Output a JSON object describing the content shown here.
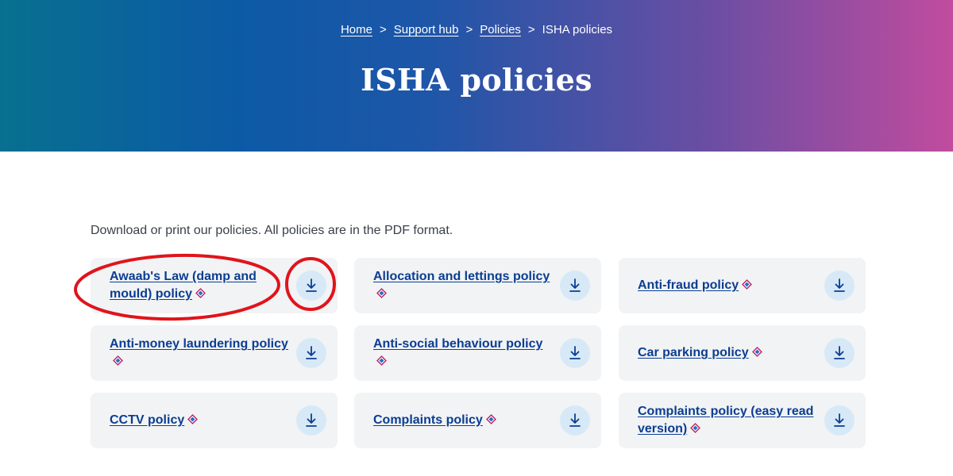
{
  "breadcrumb": {
    "home": "Home",
    "support_hub": "Support hub",
    "policies": "Policies",
    "current": "ISHA policies",
    "separator": ">"
  },
  "page": {
    "title": "ISHA policies",
    "intro": "Download or print our policies. All policies are in the PDF format."
  },
  "colors": {
    "link": "#0b3d91",
    "card_bg": "#f1f3f5",
    "download_circle": "#d7e9f7",
    "annotation_red": "#e0141b"
  },
  "policies": [
    {
      "label": "Awaab's Law (damp and mould) policy",
      "icon": "pdf-icon",
      "action_icon": "download-icon"
    },
    {
      "label": "Allocation and lettings policy",
      "icon": "pdf-icon",
      "action_icon": "download-icon"
    },
    {
      "label": "Anti-fraud policy",
      "icon": "pdf-icon",
      "action_icon": "download-icon"
    },
    {
      "label": "Anti-money laundering policy",
      "icon": "pdf-icon",
      "action_icon": "download-icon"
    },
    {
      "label": "Anti-social behaviour policy",
      "icon": "pdf-icon",
      "action_icon": "download-icon"
    },
    {
      "label": "Car parking policy",
      "icon": "pdf-icon",
      "action_icon": "download-icon"
    },
    {
      "label": "CCTV policy",
      "icon": "pdf-icon",
      "action_icon": "download-icon"
    },
    {
      "label": "Complaints policy",
      "icon": "pdf-icon",
      "action_icon": "download-icon"
    },
    {
      "label": "Complaints policy (easy read version)",
      "icon": "pdf-icon",
      "action_icon": "download-icon"
    }
  ]
}
